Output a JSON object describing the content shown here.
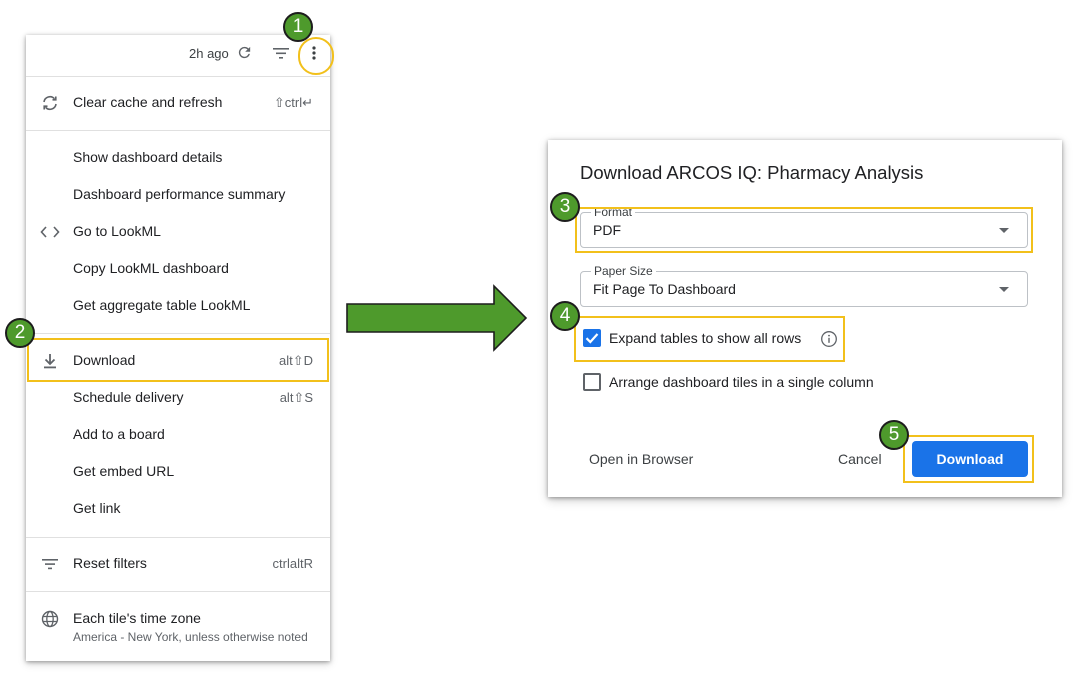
{
  "menu": {
    "topbar": {
      "time": "2h ago",
      "refresh_icon": "refresh-icon",
      "filter_icon": "filter-icon",
      "more_icon": "more-vert-icon"
    },
    "items": [
      {
        "label": "Clear cache and refresh",
        "shortcut": "⇧ctrl↵",
        "icon": "refresh-icon"
      },
      {
        "label": "Show dashboard details"
      },
      {
        "label": "Dashboard performance summary"
      },
      {
        "label": "Go to LookML",
        "icon": "code-icon"
      },
      {
        "label": "Copy LookML dashboard"
      },
      {
        "label": "Get aggregate table LookML"
      },
      {
        "label": "Download",
        "shortcut": "alt⇧D",
        "icon": "download-icon"
      },
      {
        "label": "Schedule delivery",
        "shortcut": "alt⇧S"
      },
      {
        "label": "Add to a board"
      },
      {
        "label": "Get embed URL"
      },
      {
        "label": "Get link"
      },
      {
        "label": "Reset filters",
        "shortcut": "ctrlaltR",
        "icon": "filter-icon"
      },
      {
        "label": "Each tile's time zone",
        "sublabel": "America - New York, unless otherwise noted",
        "icon": "globe-icon"
      }
    ]
  },
  "dialog": {
    "title": "Download ARCOS IQ: Pharmacy Analysis",
    "format": {
      "label": "Format",
      "value": "PDF"
    },
    "paper_size": {
      "label": "Paper Size",
      "value": "Fit Page To Dashboard"
    },
    "expand_tables": {
      "label": "Expand tables to show all rows",
      "checked": true,
      "info_icon": "info-icon"
    },
    "single_column": {
      "label": "Arrange dashboard tiles in a single column",
      "checked": false
    },
    "open_in_browser": "Open in Browser",
    "cancel": "Cancel",
    "download": "Download"
  },
  "badges": [
    "1",
    "2",
    "3",
    "4",
    "5"
  ],
  "colors": {
    "highlight": "#f2c01b",
    "badge": "#4e9a2c",
    "arrow": "#4e9a2c",
    "primary": "#1a73e8"
  }
}
